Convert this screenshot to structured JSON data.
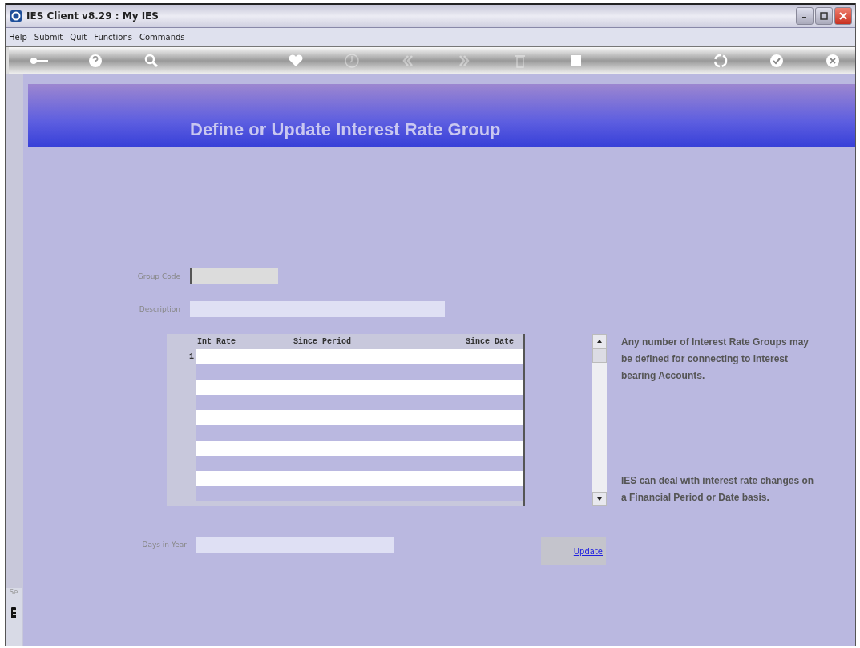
{
  "window": {
    "title": "IES Client v8.29 : My IES"
  },
  "menu": [
    "Help",
    "Submit",
    "Quit",
    "Functions",
    "Commands"
  ],
  "toolbar": [
    {
      "kind": "key",
      "disabled": false
    },
    {
      "kind": "help",
      "disabled": false
    },
    {
      "kind": "search",
      "disabled": false
    },
    {
      "kind": "heart",
      "disabled": false
    },
    {
      "kind": "clock",
      "disabled": true
    },
    {
      "kind": "rewind",
      "disabled": true
    },
    {
      "kind": "forward",
      "disabled": true
    },
    {
      "kind": "trash",
      "disabled": true
    },
    {
      "kind": "square",
      "disabled": false
    },
    {
      "kind": "recycle",
      "disabled": false
    },
    {
      "kind": "check",
      "disabled": false
    },
    {
      "kind": "cancel",
      "disabled": false
    }
  ],
  "header": {
    "title": "Define or Update Interest Rate Group"
  },
  "form": {
    "group_code_label": "Group Code",
    "description_label": "Description",
    "days_label": "Days in Year"
  },
  "table": {
    "columns": [
      "Int Rate",
      "Since Period",
      "Since Date"
    ],
    "rows": [
      {
        "number": "1"
      }
    ]
  },
  "help_texts": [
    "Any number of Interest Rate Groups may be defined for connecting to interest bearing Accounts.",
    "IES can deal with interest rate changes on a Financial Period or Date basis."
  ],
  "update_link": "Update",
  "side_panel": {
    "label": "Se"
  }
}
